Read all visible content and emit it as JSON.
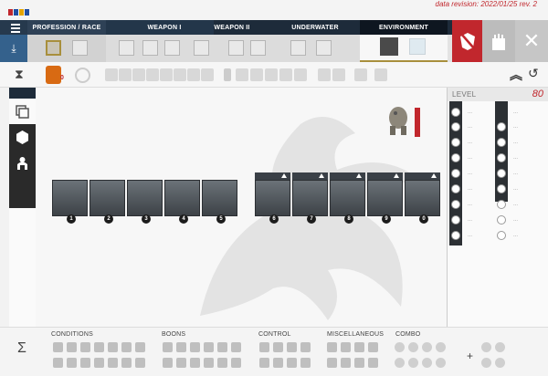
{
  "revision": {
    "line1": "data revision: 2022/01/25 rev. 2",
    "line2": ""
  },
  "nav": {
    "tabs": [
      {
        "label": "PROFESSION / RACE"
      },
      {
        "label": "WEAPON I"
      },
      {
        "label": "WEAPON II"
      },
      {
        "label": "UNDERWATER"
      },
      {
        "label": "ENVIRONMENT"
      }
    ],
    "menu_icon": "hamburger-icon",
    "download_icon": "download-icon",
    "no_buffs_icon": "no-buffs-icon",
    "castle_icon": "castle-icon",
    "close_icon": "close-icon"
  },
  "toolbar": {
    "food_badge": "0",
    "hourglass_icon": "hourglass-icon",
    "collapse_icon": "chevrons-up-icon",
    "reset_icon": "undo-icon"
  },
  "skills": {
    "numbers": [
      "1",
      "2",
      "3",
      "4",
      "5",
      "6",
      "7",
      "8",
      "9",
      "0"
    ]
  },
  "attributes": {
    "level_label": "LEVEL",
    "level_value": "80",
    "left_values": [
      "...",
      "...",
      "...",
      "...",
      "...",
      "...",
      "...",
      "...",
      "...",
      "..."
    ],
    "right_values": [
      "...",
      "...",
      "...",
      "...",
      "...",
      "...",
      "...",
      "...",
      "..."
    ]
  },
  "bottombar": {
    "sigma": "Σ",
    "conditions_label": "CONDITIONS",
    "boons_label": "BOONS",
    "control_label": "CONTROL",
    "misc_label": "MISCELLANEOUS",
    "combo_label": "COMBO",
    "plus": "+"
  },
  "colors": {
    "accent_red": "#c1272d",
    "nav_dark": "#1d2b3a",
    "gold": "#a88f3c"
  }
}
